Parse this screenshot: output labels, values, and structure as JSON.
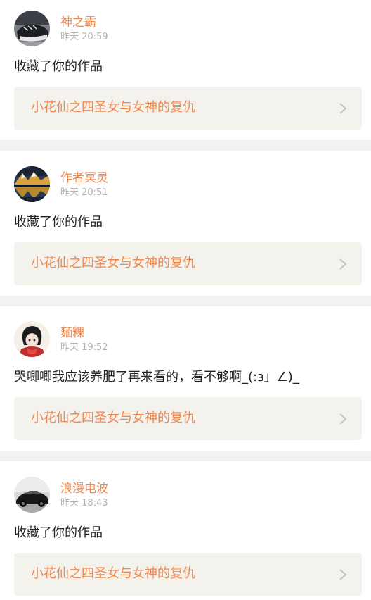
{
  "colors": {
    "accent": "#f0884e",
    "timestamp": "#b0b0b0",
    "link_bg": "#f3f2ec",
    "separator": "#f2f2f2",
    "chevron": "#c4c4c4"
  },
  "items": [
    {
      "username": "神之霸",
      "time": "昨天 20:59",
      "message": "收藏了你的作品",
      "work_title": "小花仙之四圣女与女神的复仇",
      "avatar_icon": "sneaker-photo-avatar"
    },
    {
      "username": "作者冥灵",
      "time": "昨天 20:51",
      "message": "收藏了你的作品",
      "work_title": "小花仙之四圣女与女神的复仇",
      "avatar_icon": "mountain-lake-avatar"
    },
    {
      "username": "麵粿",
      "time": "昨天 19:52",
      "message": "哭唧唧我应该养肥了再来看的，看不够啊_(:з」∠)_",
      "work_title": "小花仙之四圣女与女神的复仇",
      "avatar_icon": "anime-girl-avatar"
    },
    {
      "username": "浪漫电波",
      "time": "昨天 18:43",
      "message": "收藏了你的作品",
      "work_title": "小花仙之四圣女与女神的复仇",
      "avatar_icon": "sports-car-avatar"
    }
  ]
}
